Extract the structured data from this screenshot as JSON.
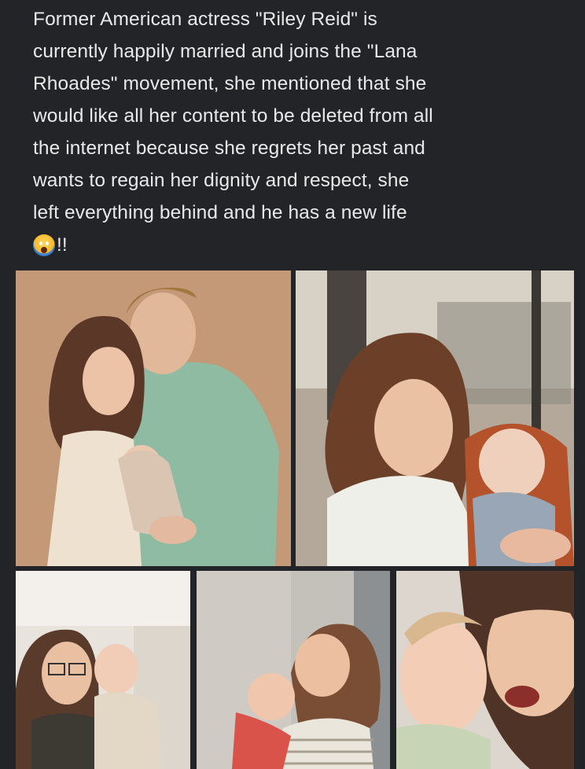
{
  "post": {
    "lines": [
      "Former American actress \"Riley Reid\" is",
      "currently happily married and joins the \"Lana",
      "Rhoades\" movement, she mentioned that she",
      "would like all her content to be deleted from all",
      "the internet because she regrets her past and",
      "wants to regain her dignity and respect, she",
      "left everything behind and he has a new life"
    ],
    "emoji_icon": "face-screaming-in-fear-icon",
    "exclamation": "!!"
  },
  "photos": [
    {
      "name": "photo-couple-with-newborn"
    },
    {
      "name": "photo-woman-holding-baby-window"
    },
    {
      "name": "photo-woman-glasses-with-baby"
    },
    {
      "name": "photo-woman-hugging-baby"
    },
    {
      "name": "photo-selfie-with-baby"
    }
  ]
}
